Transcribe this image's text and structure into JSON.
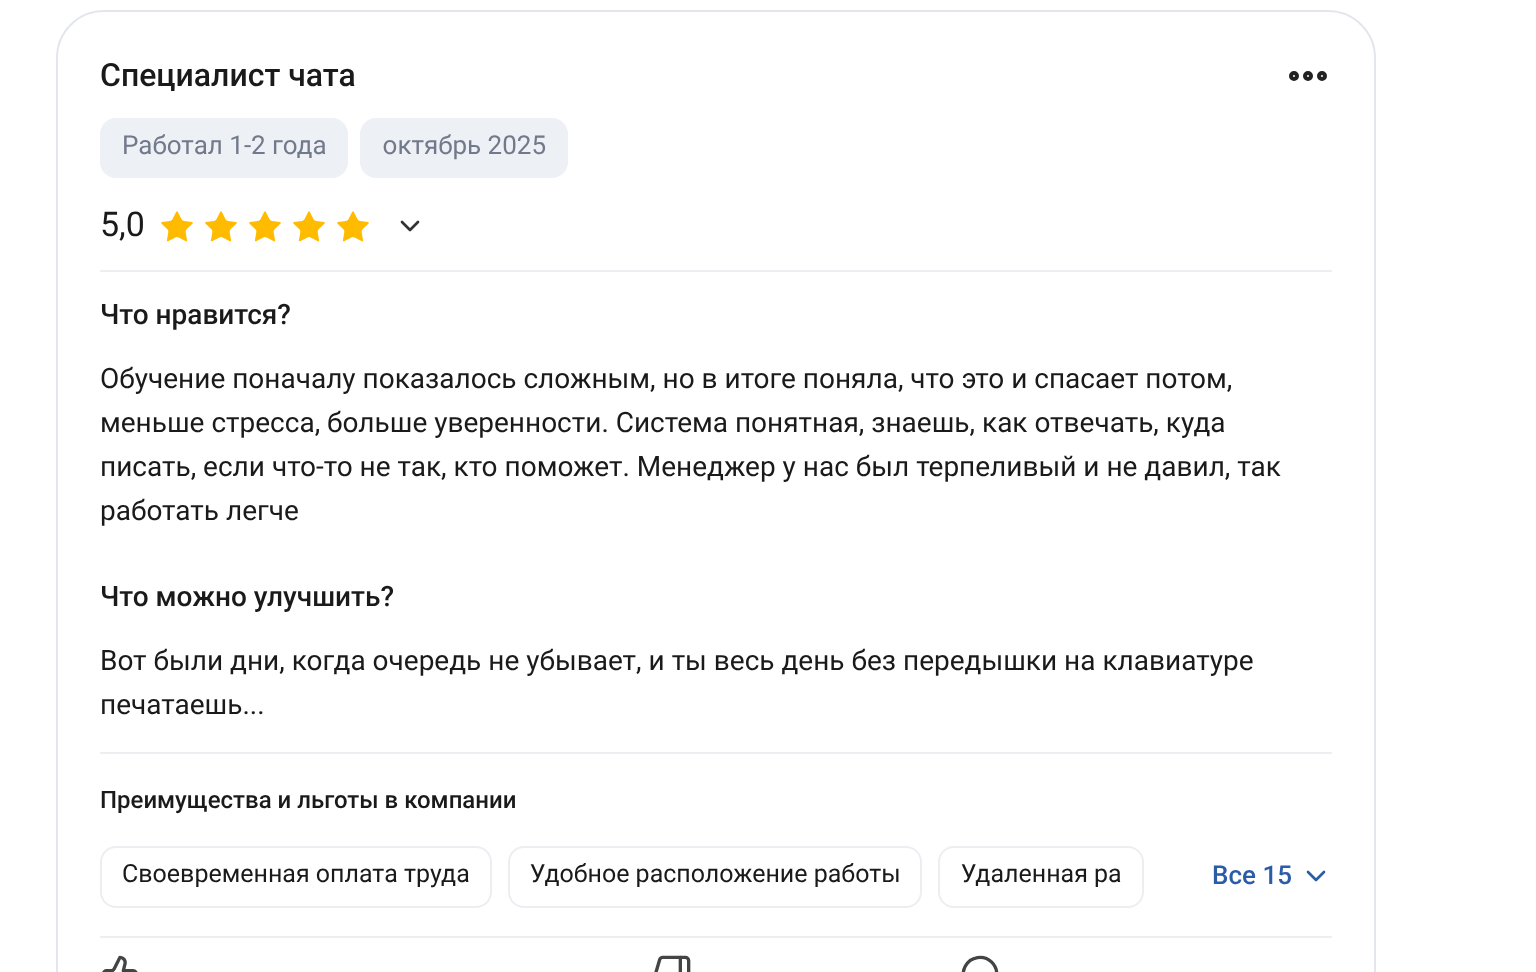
{
  "review": {
    "title": "Специалист чата",
    "tags": [
      "Работал 1-2 года",
      "октябрь 2025"
    ],
    "rating": "5,0",
    "stars": 5,
    "sections": [
      {
        "heading": "Что нравится?",
        "text": "Обучение поначалу показалось сложным, но в итоге поняла, что это и спасает потом, меньше стресса, больше уверенности. Система понятная, знаешь, как отвечать, куда писать, если что-то не так, кто поможет. Менеджер у нас был терпеливый и не давил, так работать легче"
      },
      {
        "heading": "Что можно улучшить?",
        "text": "Вот были дни, когда очередь не убывает, и ты весь день без передышки на клавиатуре печатаешь..."
      }
    ],
    "benefits": {
      "heading": "Преимущества и льготы в компании",
      "items": [
        "Своевременная оплата труда",
        "Удобное расположение работы",
        "Удаленная ра"
      ],
      "more": "Все 15"
    }
  }
}
